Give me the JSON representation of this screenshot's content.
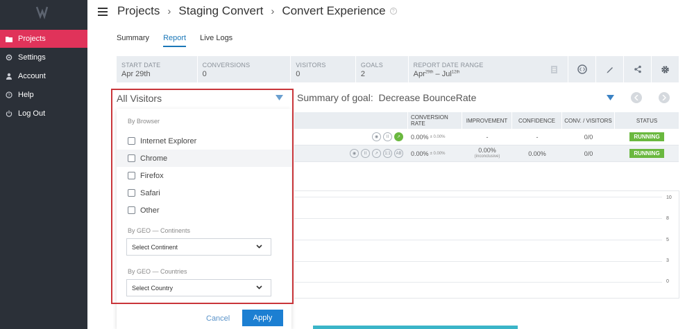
{
  "sidebar": {
    "items": [
      {
        "label": "Projects",
        "icon": "folder-icon"
      },
      {
        "label": "Settings",
        "icon": "gear-icon"
      },
      {
        "label": "Account",
        "icon": "user-icon"
      },
      {
        "label": "Help",
        "icon": "help-icon"
      },
      {
        "label": "Log Out",
        "icon": "power-icon"
      }
    ],
    "active_color": "#e0335a"
  },
  "header": {
    "crumbs": [
      "Projects",
      "Staging Convert",
      "Convert Experience"
    ],
    "separator": "›"
  },
  "tabs": [
    "Summary",
    "Report",
    "Live Logs"
  ],
  "stats": {
    "start_date_label": "START DATE",
    "start_date": "Apr 29th",
    "conversions_label": "CONVERSIONS",
    "conversions": "0",
    "visitors_label": "VISITORS",
    "visitors": "0",
    "goals_label": "GOALS",
    "goals": "2",
    "range_label": "REPORT DATE RANGE",
    "range_from": "Apr",
    "range_from_sup": "29th",
    "range_sep": " – ",
    "range_to": "Jul",
    "range_to_sup": "12th"
  },
  "filter": {
    "selected": "All Visitors",
    "browser_title": "By Browser",
    "browsers": [
      "Internet Explorer",
      "Chrome",
      "Firefox",
      "Safari",
      "Other"
    ],
    "geo_continents_title": "By GEO — Continents",
    "continent_placeholder": "Select Continent",
    "geo_countries_title": "By GEO — Countries",
    "country_placeholder": "Select Country",
    "cancel_label": "Cancel",
    "apply_label": "Apply"
  },
  "goal_summary": {
    "label": "Summary of goal:",
    "goal": "Decrease BounceRate"
  },
  "results": {
    "headers": [
      "CONVERSION RATE",
      "IMPROVEMENT",
      "CONFIDENCE",
      "CONV. / VISITORS",
      "STATUS"
    ],
    "rows": [
      {
        "rate": "0.00%",
        "rate_pm": "± 0.00%",
        "improvement": "-",
        "improvement_sub": "",
        "confidence": "-",
        "conv": "0/0",
        "status": "RUNNING"
      },
      {
        "rate": "0.00%",
        "rate_pm": "± 0.00%",
        "improvement": "0.00%",
        "improvement_sub": "(inconclusive)",
        "confidence": "0.00%",
        "conv": "0/0",
        "status": "RUNNING"
      }
    ],
    "row_icons": [
      "1:1",
      "AB"
    ]
  },
  "chart": {
    "y_ticks": [
      "10",
      "8",
      "5",
      "3",
      "0"
    ]
  }
}
